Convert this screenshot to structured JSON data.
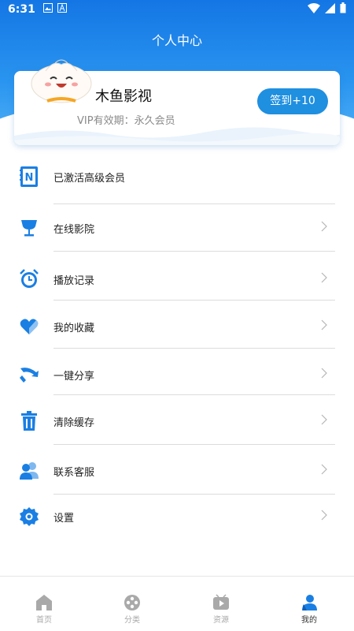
{
  "status_bar": {
    "time": "6:31"
  },
  "header": {
    "title": "个人中心"
  },
  "profile": {
    "username": "木鱼影视",
    "vip_text": "VIP有效期：永久会员",
    "signin_label": "签到+10"
  },
  "menu": {
    "items": [
      {
        "label": "已激活高级会员",
        "icon": "member-icon"
      },
      {
        "label": "在线影院",
        "icon": "trophy-cup-icon"
      },
      {
        "label": "播放记录",
        "icon": "alarm-clock-icon"
      },
      {
        "label": "我的收藏",
        "icon": "heart-icon"
      },
      {
        "label": "一键分享",
        "icon": "share-icon"
      },
      {
        "label": "清除缓存",
        "icon": "trash-icon"
      },
      {
        "label": "联系客服",
        "icon": "contacts-icon"
      },
      {
        "label": "设置",
        "icon": "gear-icon"
      }
    ]
  },
  "bottom_nav": {
    "items": [
      {
        "label": "首页",
        "icon": "home-icon"
      },
      {
        "label": "分类",
        "icon": "category-icon"
      },
      {
        "label": "资源",
        "icon": "play-icon"
      },
      {
        "label": "我的",
        "icon": "profile-icon"
      }
    ],
    "active": "我的"
  },
  "colors": {
    "header_blue": "#1476e4",
    "accent": "#1f8fe0",
    "icon_blue": "#1a7fe3"
  }
}
